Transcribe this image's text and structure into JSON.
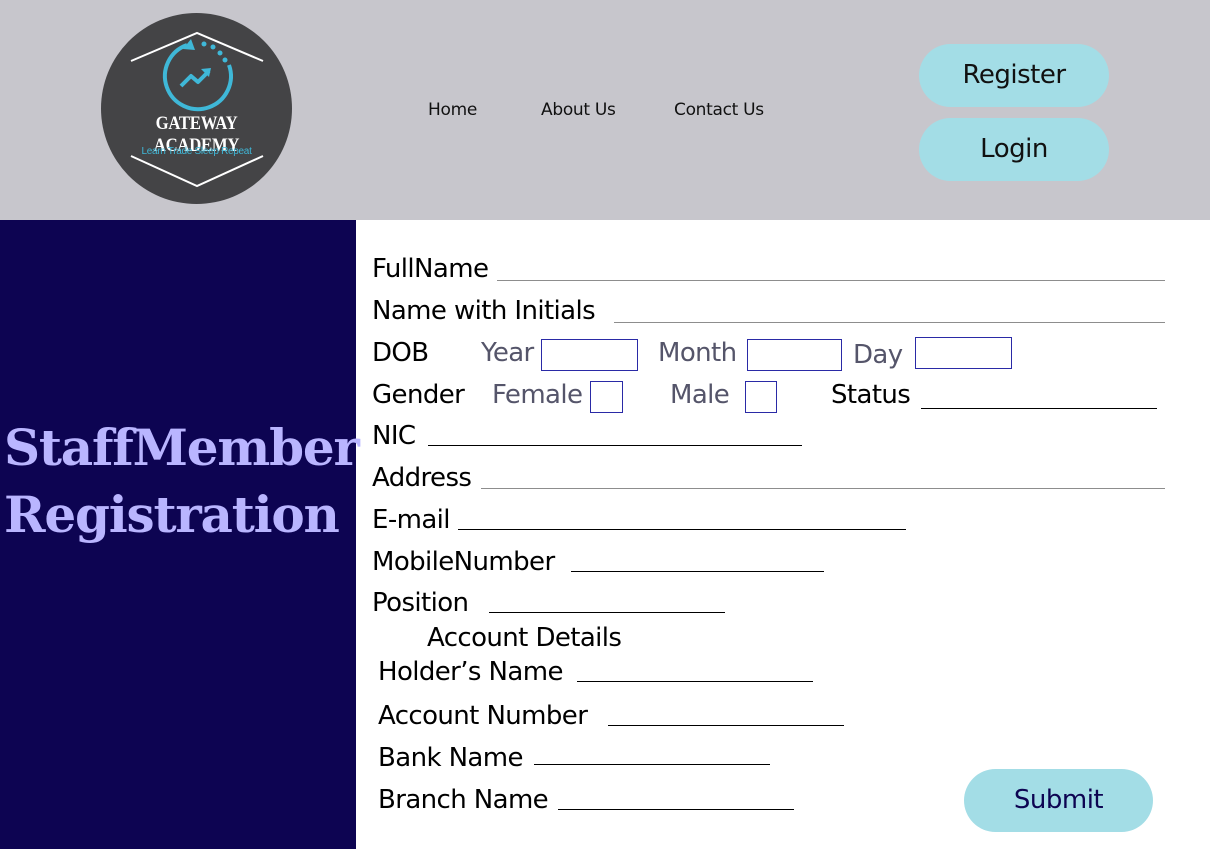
{
  "logo": {
    "name": "GATEWAY ACADEMY",
    "tagline": "Learn Trade Sleep Repeat",
    "icon": "rising-arrow-cycle-icon"
  },
  "nav": {
    "home": "Home",
    "about": "About Us",
    "contact": "Contact Us"
  },
  "auth": {
    "register": "Register",
    "login": "Login"
  },
  "sidebar": {
    "title_line1": "StaffMember",
    "title_line2": "Registration"
  },
  "form": {
    "full_name": "FullName",
    "name_initials": "Name with Initials",
    "dob": "DOB",
    "year": "Year",
    "month": "Month",
    "day": "Day",
    "gender": "Gender",
    "female": "Female",
    "male": "Male",
    "status": "Status",
    "nic": "NIC",
    "address": "Address",
    "email": "E-mail",
    "mobile": "MobileNumber",
    "position": "Position",
    "account_heading": "Account Details",
    "holder_name": "Holder’s Name",
    "account_number": "Account Number",
    "bank_name": "Bank Name",
    "branch_name": "Branch Name",
    "submit": "Submit"
  },
  "colors": {
    "header_bg": "#c7c6cc",
    "sidebar_bg": "#0d0452",
    "sidebar_text": "#b9b5ff",
    "button_bg": "#a3dde6",
    "logo_bg": "#444446",
    "logo_accent": "#3fb8d8"
  }
}
